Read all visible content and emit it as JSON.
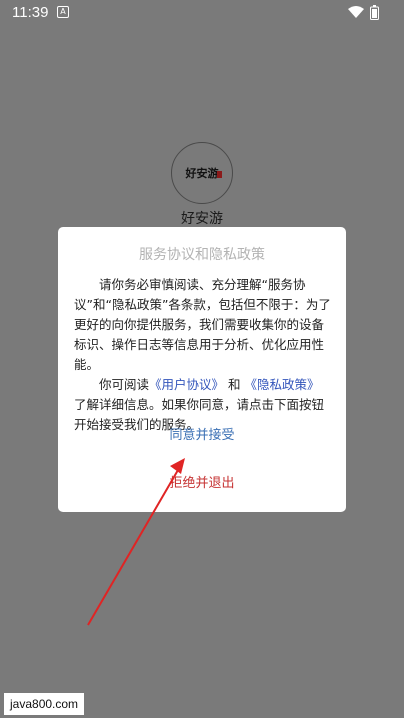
{
  "status_bar": {
    "time": "11:39",
    "notification_glyph": "A"
  },
  "app": {
    "logo_text": "好安游",
    "name": "好安游"
  },
  "dialog": {
    "title": "服务协议和隐私政策",
    "para1": "请你务必审慎阅读、充分理解“服务协议”和“隐私政策”各条款，包括但不限于：为了更好的向你提供服务，我们需要收集你的设备标识、操作日志等信息用于分析、优化应用性能。",
    "para2_prefix": "你可阅读",
    "user_agreement_link": "《用户协议》",
    "and": "和",
    "privacy_link": "《隐私政策》",
    "para2_suffix": "了解详细信息。如果你同意，请点击下面按钮开始接受我们的服务。",
    "agree_label": "同意并接受",
    "refuse_label": "拒绝并退出"
  },
  "watermark": "java800.com",
  "colors": {
    "link": "#3355bb",
    "agree": "#3a6fb4",
    "refuse": "#c63333",
    "annotation_arrow": "#e02424"
  }
}
